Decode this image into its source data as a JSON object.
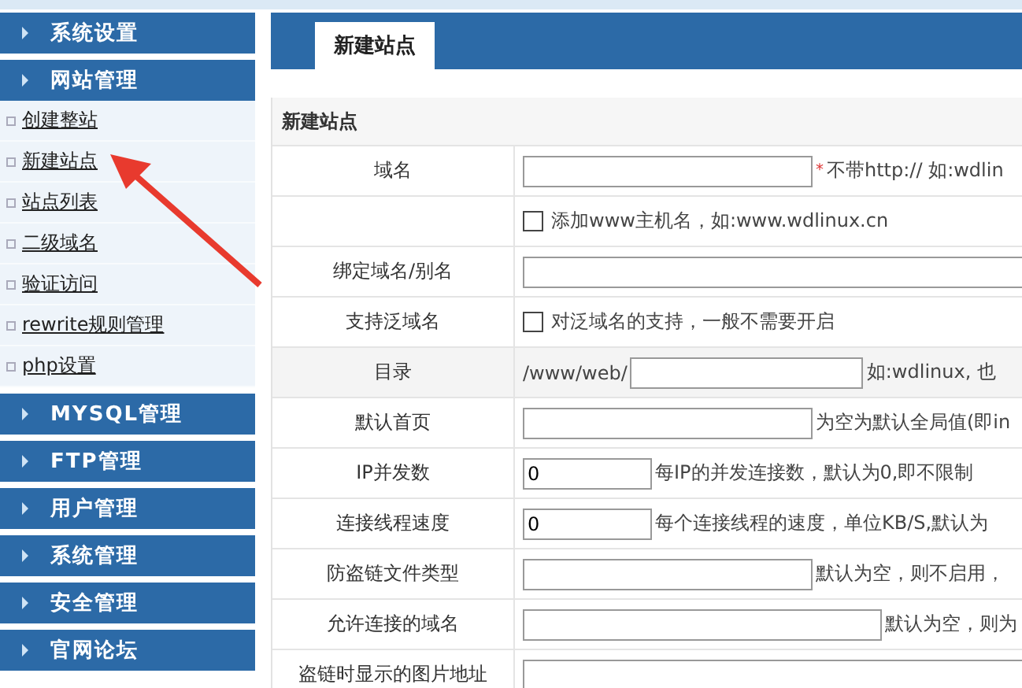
{
  "sidebar": {
    "groups": [
      {
        "label": "系统设置"
      },
      {
        "label": "网站管理",
        "items": [
          "创建整站",
          "新建站点",
          "站点列表",
          "二级域名",
          "验证访问",
          "rewrite规则管理",
          "php设置"
        ]
      },
      {
        "label": "MYSQL管理"
      },
      {
        "label": "FTP管理"
      },
      {
        "label": "用户管理"
      },
      {
        "label": "系统管理"
      },
      {
        "label": "安全管理"
      },
      {
        "label": "官网论坛"
      }
    ]
  },
  "tabs": [
    {
      "label": "新建站点",
      "selected": true
    }
  ],
  "form": {
    "title": "新建站点",
    "rows": [
      {
        "kind": "input",
        "label": "域名",
        "mark": "*",
        "hint": "不带http:// 如:wdlin"
      },
      {
        "kind": "checkbox",
        "checked": false,
        "hint": "添加www主机名，如:www.wdlinux.cn"
      },
      {
        "kind": "long_input",
        "label": "绑定域名/别名"
      },
      {
        "kind": "checkbox",
        "label": "支持泛域名",
        "checked": false,
        "hint": "对泛域名的支持，一般不需要开启"
      },
      {
        "kind": "path_input",
        "label": "目录",
        "prefix": "/www/web/",
        "shaded": true,
        "hint": "如:wdlinux, 也"
      },
      {
        "kind": "input",
        "label": "默认首页",
        "hint": "为空为默认全局值(即in"
      },
      {
        "kind": "short_input",
        "label": "IP并发数",
        "value": "0",
        "hint": "每IP的并发连接数，默认为0,即不限制"
      },
      {
        "kind": "short_input",
        "label": "连接线程速度",
        "value": "0",
        "hint": "每个连接线程的速度，单位KB/S,默认为"
      },
      {
        "kind": "input",
        "label": "防盗链文件类型",
        "hint": "默认为空，则不启用，"
      },
      {
        "kind": "wide_input",
        "label": "允许连接的域名",
        "hint": "默认为空，则为"
      },
      {
        "kind": "long_input",
        "label": "盗链时显示的图片地址"
      }
    ]
  }
}
